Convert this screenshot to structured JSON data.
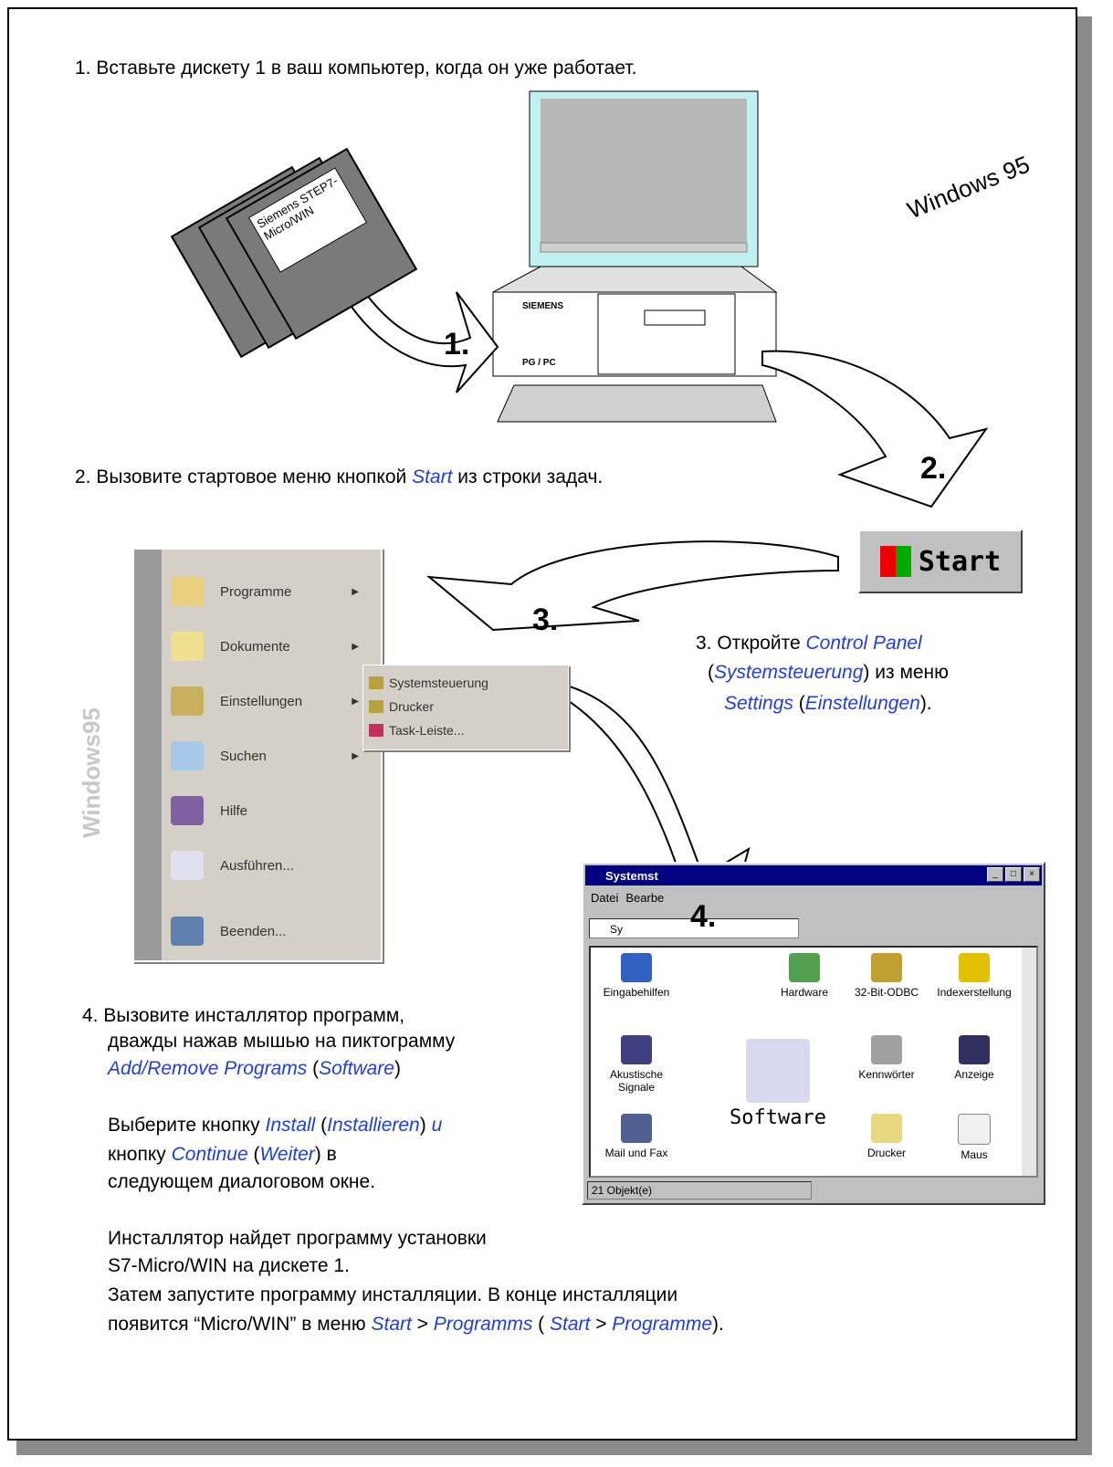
{
  "step1": {
    "text": "1. Вставьте дискету 1 в ваш компьютер, когда он уже работает."
  },
  "step2": {
    "pre": "2. Вызовите стартовое меню кнопкой ",
    "em": "Start",
    "post": " из строки задач."
  },
  "step3": {
    "l1a": "3. Откройте ",
    "l1em": "Control Panel",
    "l2a": "(",
    "l2em": "Systemsteuerung",
    "l2b": ") из меню",
    "l3em1": "Settings",
    "l3a": " (",
    "l3em2": "Einstellungen",
    "l3b": ")."
  },
  "step4": {
    "l1": "4. Вызовите инсталлятор программ,",
    "l2": "дважды нажав мышью на пиктограмму",
    "l3em1": "Add/Remove Programs",
    "l3a": " (",
    "l3em2": "Software",
    "l3b": ")",
    "l4a": "Выберите кнопку ",
    "l4em1": "Install",
    "l4b": " (",
    "l4em2": "Installieren",
    "l4c": ") ",
    "l4em3": "u",
    "l5a": "кнопку ",
    "l5em1": "Continue",
    "l5b": " (",
    "l5em2": "Weiter",
    "l5c": ")  в",
    "l6": "следующем  диалоговом окне.",
    "l7": "Инсталлятор найдет программу установки",
    "l8": "S7-Micro/WIN на дискете  1.",
    "l9": "Затем запустите программу инсталляции. В конце инсталляции",
    "l10a": "появится “Micro/WIN” в меню ",
    "l10em1": "Start",
    "l10b": " > ",
    "l10em2": "Programms",
    "l10c": " ( ",
    "l10em3": "Start",
    "l10d": " > ",
    "l10em4": "Programme",
    "l10e": ")."
  },
  "arrows": {
    "a1": "1.",
    "a2": "2.",
    "a3": "3.",
    "a4": "4."
  },
  "floppy": {
    "label": "Siemens STEP7-Micro/WIN"
  },
  "pc": {
    "brand": "SIEMENS",
    "model": "PG / PC"
  },
  "logo": {
    "text": "Windows 95"
  },
  "startmenu": {
    "band": "Windows95",
    "items": [
      "Programme",
      "Dokumente",
      "Einstellungen",
      "Suchen",
      "Hilfe",
      "Ausführen...",
      "Beenden..."
    ],
    "submenu": [
      "Systemsteuerung",
      "Drucker",
      "Task-Leiste..."
    ]
  },
  "start_button": {
    "label": "Start"
  },
  "control_panel": {
    "title": "Systemst",
    "menu": [
      "Datei",
      "Bearbe"
    ],
    "address": "Sy",
    "icons": [
      "Eingabehilfen",
      "Hardware",
      "32-Bit-ODBC",
      "Indexerstellung",
      "Akustische Signale",
      "Kennwörter",
      "Anzeige",
      "Mail und Fax",
      "Software",
      "Drucker",
      "Maus"
    ],
    "status": "21 Objekt(e)"
  }
}
